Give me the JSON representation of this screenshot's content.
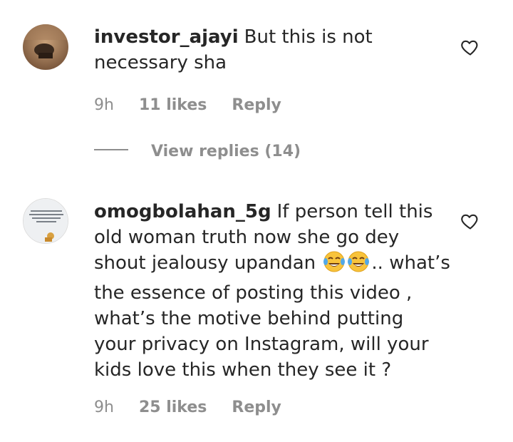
{
  "comments": [
    {
      "username": "investor_ajayi",
      "text": "But this is not necessary sha",
      "time": "9h",
      "likes": "11 likes",
      "reply": "Reply",
      "view_replies": "View replies (14)"
    },
    {
      "username": "omogbolahan_5g",
      "text_before_emoji": "If person tell this old woman truth now she go dey shout jealousy upandan",
      "emoji": "😂😂",
      "text_after_emoji": ".. what’s the essence of posting this video , what’s the motive behind putting your privacy on Instagram, will your kids love this when they see it ?",
      "avatar_text": "Never make someone a priority when all you are to them is an option",
      "time": "9h",
      "likes": "25 likes",
      "reply": "Reply"
    }
  ],
  "icons": {
    "like": "heart-outline-icon"
  }
}
